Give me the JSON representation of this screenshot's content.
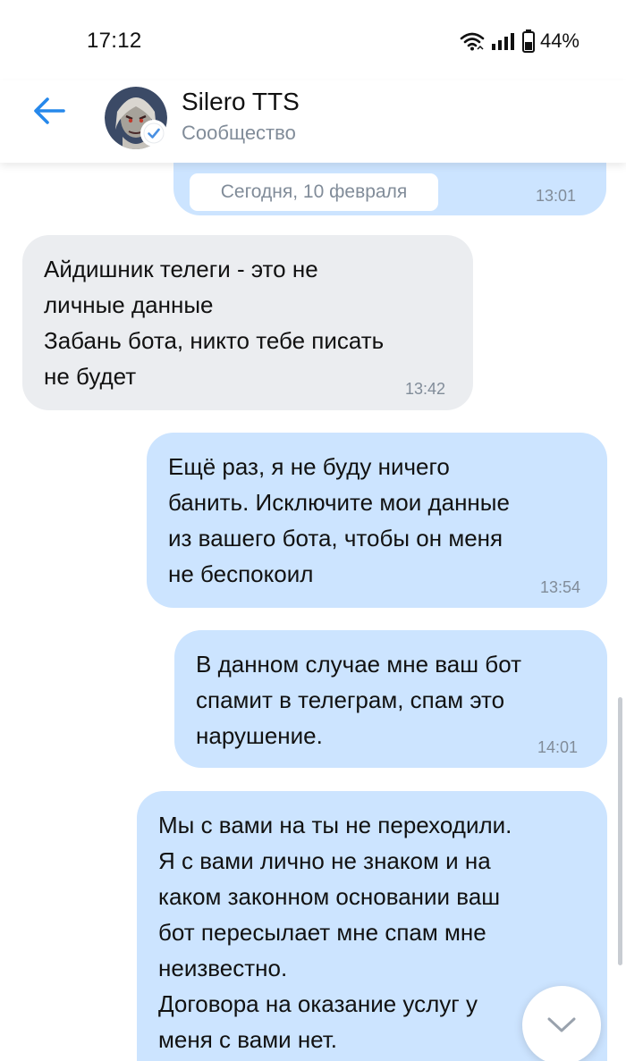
{
  "status_bar": {
    "time": "17:12",
    "battery": "44%"
  },
  "header": {
    "title": "Silero TTS",
    "subtitle": "Сообщество"
  },
  "date_separator": "Сегодня, 10 февраля",
  "messages": [
    {
      "direction": "out",
      "text": "",
      "time": "13:01"
    },
    {
      "direction": "in",
      "text": "Айдишник телеги - это не\nличные данные\nЗабань бота, никто тебе писать\nне будет",
      "time": "13:42"
    },
    {
      "direction": "out",
      "text": "Ещё раз, я не буду ничего\nбанить. Исключите мои данные\nиз вашего бота, чтобы он меня\nне беспокоил",
      "time": "13:54"
    },
    {
      "direction": "out",
      "text": "В данном случае мне ваш бот\nспамит в телеграм, спам это\nнарушение.",
      "time": "14:01"
    },
    {
      "direction": "out",
      "text": "Мы с вами на ты не переходили.\nЯ с вами лично не знаком и на\nкаком законном основании ваш\nбот пересылает мне спам мне\nнеизвестно.\nДоговора на оказание услуг у\nменя с вами нет.",
      "time": ""
    }
  ],
  "colors": {
    "accent": "#2688eb",
    "bubble_out": "#cce4ff",
    "bubble_in": "#ebedf0",
    "muted": "#818c99"
  },
  "icons": [
    "back-arrow-icon",
    "verified-check-icon",
    "wifi-icon",
    "signal-icon",
    "battery-icon",
    "chevron-down-icon"
  ]
}
